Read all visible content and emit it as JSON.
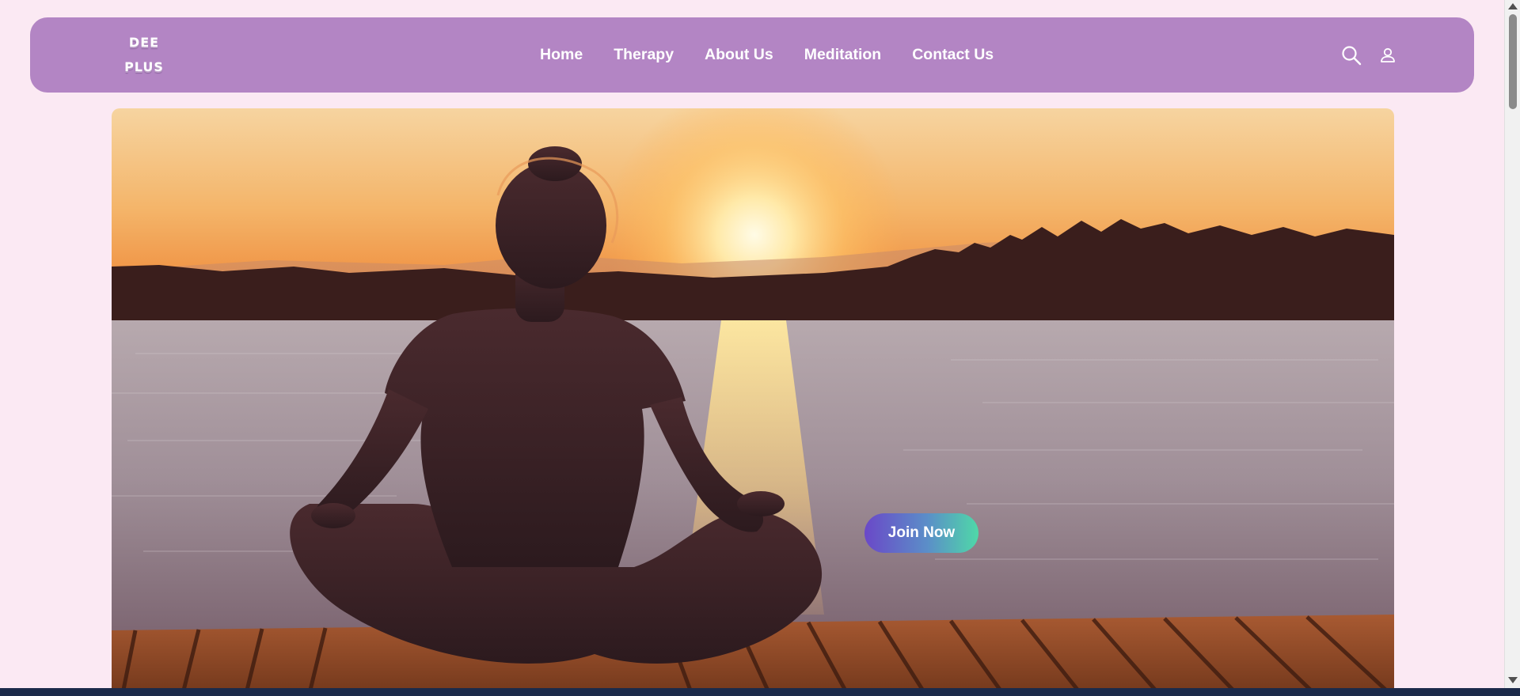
{
  "brand": {
    "line1": "DEE",
    "line2": "PLUS"
  },
  "nav": {
    "items": [
      {
        "label": "Home"
      },
      {
        "label": "Therapy"
      },
      {
        "label": "About Us"
      },
      {
        "label": "Meditation"
      },
      {
        "label": "Contact Us"
      }
    ],
    "icons": [
      "search-icon",
      "user-icon"
    ]
  },
  "hero": {
    "cta_label": "Join Now"
  },
  "colors": {
    "navbar": "#b385c4",
    "page_background": "#fbe9f3",
    "cta_gradient_start": "#6a48c8",
    "cta_gradient_end": "#4fd8a8"
  }
}
